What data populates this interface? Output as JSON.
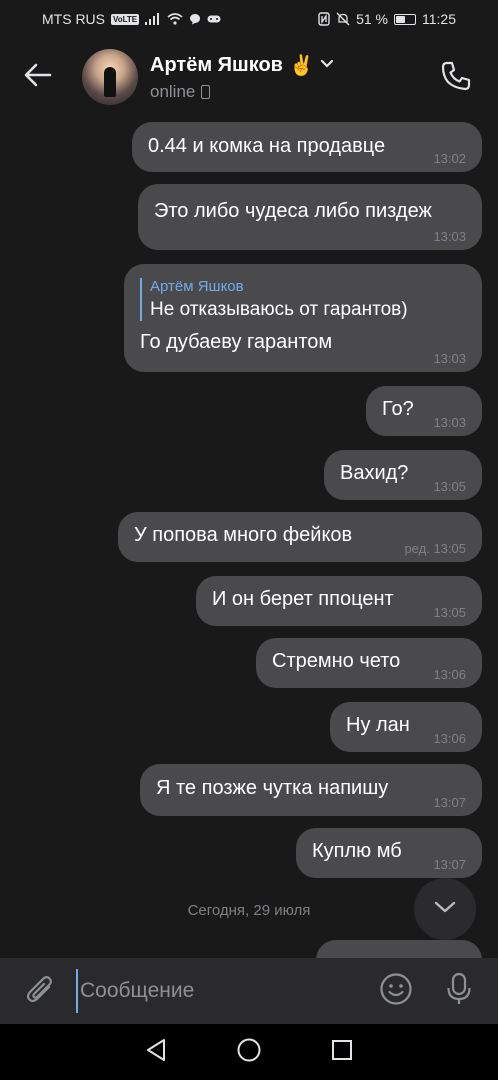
{
  "status_bar": {
    "carrier": "MTS RUS",
    "volte": "VoLTE",
    "battery_text": "51 %",
    "battery_level": 0.51,
    "time": "11:25"
  },
  "header": {
    "contact_name": "Артём Яшков",
    "emoji": "✌️",
    "presence": "online"
  },
  "messages": [
    {
      "text": "0.44 и комка на продавце",
      "time": "13:02"
    },
    {
      "text": "Это либо чудеса либо пиздеж",
      "time": "13:03"
    },
    {
      "reply_author": "Артём Яшков",
      "reply_text": "Не отказываюсь от гарантов)",
      "text": "Го дубаеву гарантом",
      "time": "13:03"
    },
    {
      "text": "Го?",
      "time": "13:03"
    },
    {
      "text": "Вахид?",
      "time": "13:05"
    },
    {
      "text": "У попова много фейков",
      "edited": "ред.",
      "time": "13:05"
    },
    {
      "text": "И он берет ппоцент",
      "time": "13:05"
    },
    {
      "text": "Стремно чето",
      "time": "13:06"
    },
    {
      "text": "Ну лан",
      "time": "13:06"
    },
    {
      "text": "Я те позже чутка напишу",
      "time": "13:07"
    },
    {
      "text": "Куплю мб",
      "time": "13:07"
    }
  ],
  "date_separator": "Сегодня, 29 июля",
  "composer": {
    "placeholder": "Сообщение"
  },
  "icons": {
    "back": "back-arrow-icon",
    "call": "phone-call-icon",
    "attach": "paperclip-icon",
    "emoji": "smiley-icon",
    "mic": "microphone-icon",
    "scroll_down": "chevron-down-icon",
    "nav_back": "triangle-back-icon",
    "nav_home": "circle-home-icon",
    "nav_recents": "square-recents-icon"
  },
  "colors": {
    "background": "#19191a",
    "bubble": "#4a4a4c",
    "accent": "#71aaeb",
    "meta_text": "#7d8085"
  }
}
